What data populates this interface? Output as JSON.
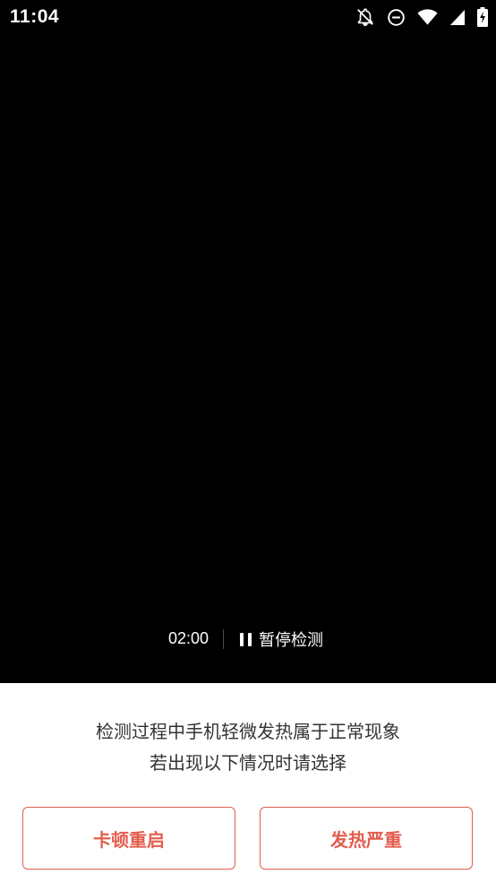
{
  "status_bar": {
    "time": "11:04",
    "icons": [
      "notifications-off-icon",
      "do-not-disturb-icon",
      "wifi-icon",
      "cellular-signal-icon",
      "battery-charging-icon"
    ]
  },
  "controls": {
    "timer": "02:00",
    "pause_label": "暂停检测",
    "pause_icon": "pause-icon"
  },
  "panel": {
    "notice_line1": "检测过程中手机轻微发热属于正常现象",
    "notice_line2": "若出现以下情况时请选择",
    "buttons": [
      {
        "label": "卡顿重启"
      },
      {
        "label": "发热严重"
      }
    ]
  },
  "colors": {
    "accent": "#e35d4e",
    "background": "#000000",
    "panel": "#ffffff",
    "text": "#333333"
  }
}
